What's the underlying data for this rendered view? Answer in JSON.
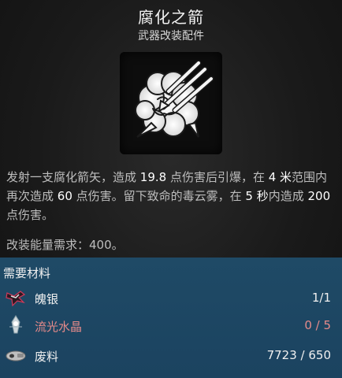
{
  "header": {
    "title": "腐化之箭",
    "subtitle": "武器改装配件"
  },
  "icon": {
    "semantic": "corrupted-arrow-burst-icon"
  },
  "description": {
    "p1": "发射一支腐化箭矢，造成 ",
    "v1": "19.8",
    "p2": " 点伤害后引爆，在 ",
    "v2": "4 米",
    "p3": "范围内再次造成 ",
    "v3": "60",
    "p4": " 点伤害。留下致命的毒云雾，在 ",
    "v4": "5 秒",
    "p5": "内造成 ",
    "v5": "200",
    "p6": " 点伤害。"
  },
  "energy": "改装能量需求：400。",
  "materials": {
    "title": "需要材料",
    "items": [
      {
        "name": "魄银",
        "count": "1/1",
        "icon": "soul-silver-icon",
        "status": "ok"
      },
      {
        "name": "流光水晶",
        "count": "0 / 5",
        "icon": "flowing-crystal-icon",
        "status": "missing"
      },
      {
        "name": "废料",
        "count": "7723 / 650",
        "icon": "scrap-icon",
        "status": "ok"
      }
    ]
  },
  "colors": {
    "materials_bg": "#1f4a66",
    "missing": "#e58a8a",
    "text": "#e6e6e6"
  }
}
